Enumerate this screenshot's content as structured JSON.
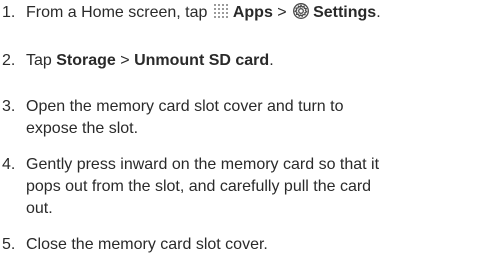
{
  "steps": [
    {
      "number": "1.",
      "prefix": "From a Home screen, tap ",
      "apps_icon": "apps-grid-icon",
      "apps_label": "Apps",
      "separator": " > ",
      "settings_icon": "settings-gear-icon",
      "settings_label": "Settings",
      "suffix": "."
    },
    {
      "number": "2.",
      "prefix": "Tap ",
      "storage_label": "Storage",
      "separator": " > ",
      "unmount_label": "Unmount SD card",
      "suffix": "."
    },
    {
      "number": "3.",
      "lines": [
        "Open the memory card slot cover and turn to",
        "expose the slot."
      ]
    },
    {
      "number": "4.",
      "lines": [
        "Gently press inward on the memory card so that it",
        "pops out from the slot, and carefully pull the card",
        "out."
      ]
    },
    {
      "number": "5.",
      "lines": [
        "Close the memory card slot cover."
      ]
    }
  ],
  "colors": {
    "text": "#2a2a2a",
    "icon_gray": "#8a8a8a"
  }
}
